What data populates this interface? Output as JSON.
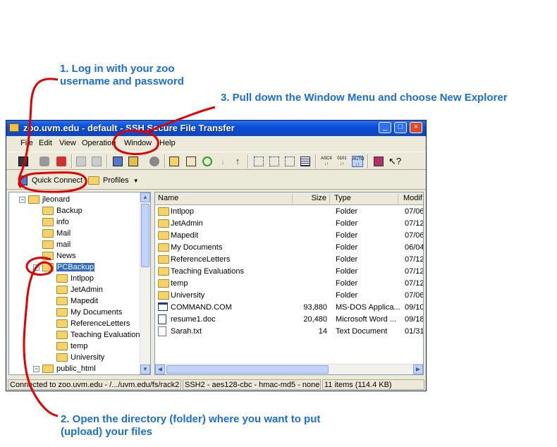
{
  "annotations": {
    "step1": "1. Log in with your zoo username and password",
    "step3": "3. Pull down the Window Menu and choose New Explorer",
    "step2": "2. Open the directory (folder) where you want to put (upload) your files"
  },
  "window": {
    "title": "zoo.uvm.edu - default - SSH Secure File Transfer"
  },
  "menu": [
    "File",
    "Edit",
    "View",
    "Operation",
    "Window",
    "Help"
  ],
  "quick_connect": {
    "label": "Quick Connect",
    "profiles_label": "Profiles"
  },
  "toolbar_text": {
    "ascii": "ASCII",
    "binary": "0101",
    "auto": "AUTO"
  },
  "tree": [
    {
      "label": "jleonard",
      "level": 0,
      "expanded": true
    },
    {
      "label": "Backup",
      "level": 1
    },
    {
      "label": "info",
      "level": 1
    },
    {
      "label": "Mail",
      "level": 1
    },
    {
      "label": "mail",
      "level": 1
    },
    {
      "label": "News",
      "level": 1
    },
    {
      "label": "PCBackup",
      "level": 1,
      "expanded": true,
      "selected": true
    },
    {
      "label": "Intlpop",
      "level": 2
    },
    {
      "label": "JetAdmin",
      "level": 2
    },
    {
      "label": "Mapedit",
      "level": 2
    },
    {
      "label": "My Documents",
      "level": 2
    },
    {
      "label": "ReferenceLetters",
      "level": 2
    },
    {
      "label": "Teaching Evaluations",
      "level": 2
    },
    {
      "label": "temp",
      "level": 2
    },
    {
      "label": "University",
      "level": 2
    },
    {
      "label": "public_html",
      "level": 1,
      "expanded": true
    }
  ],
  "list": {
    "columns": [
      "Name",
      "Size",
      "Type",
      "Modif"
    ],
    "rows": [
      {
        "name": "Intlpop",
        "size": "",
        "type": "Folder",
        "mod": "07/06",
        "icon": "folder"
      },
      {
        "name": "JetAdmin",
        "size": "",
        "type": "Folder",
        "mod": "07/12",
        "icon": "folder"
      },
      {
        "name": "Mapedit",
        "size": "",
        "type": "Folder",
        "mod": "07/06",
        "icon": "folder"
      },
      {
        "name": "My Documents",
        "size": "",
        "type": "Folder",
        "mod": "06/04",
        "icon": "folder"
      },
      {
        "name": "ReferenceLetters",
        "size": "",
        "type": "Folder",
        "mod": "07/12",
        "icon": "folder"
      },
      {
        "name": "Teaching Evaluations",
        "size": "",
        "type": "Folder",
        "mod": "07/12",
        "icon": "folder"
      },
      {
        "name": "temp",
        "size": "",
        "type": "Folder",
        "mod": "07/12",
        "icon": "folder"
      },
      {
        "name": "University",
        "size": "",
        "type": "Folder",
        "mod": "07/06",
        "icon": "folder"
      },
      {
        "name": "COMMAND.COM",
        "size": "93,880",
        "type": "MS-DOS Applica...",
        "mod": "09/10",
        "icon": "app"
      },
      {
        "name": "resume1.doc",
        "size": "20,480",
        "type": "Microsoft Word ...",
        "mod": "09/18",
        "icon": "doc"
      },
      {
        "name": "Sarah.txt",
        "size": "14",
        "type": "Text Document",
        "mod": "01/31",
        "icon": "txt"
      }
    ]
  },
  "status": {
    "connection": "Connected to zoo.uvm.edu - /.../uvm.edu/fs/rack2",
    "cipher": "SSH2 - aes128-cbc - hmac-md5 - none",
    "items": "11 items (114.4 KB)"
  },
  "colors": {
    "annotation": "#1a6fd6",
    "callout_loop": "#e00000",
    "titlebar": "#0a4fd8",
    "selection": "#316ac5"
  }
}
